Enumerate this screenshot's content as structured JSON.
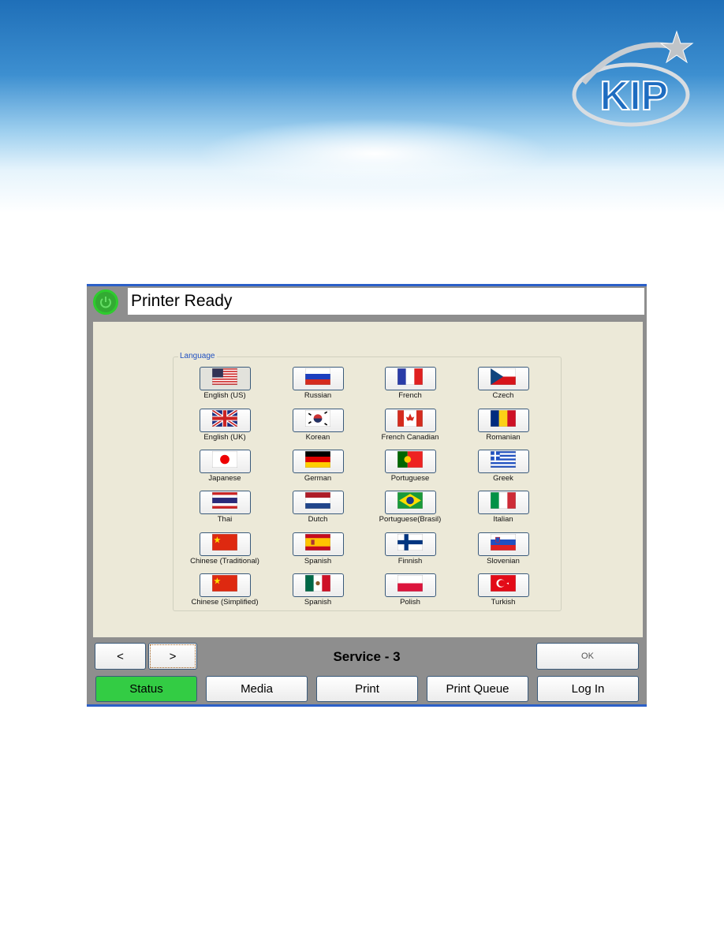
{
  "brand": {
    "logo_text": "KIP",
    "colors": {
      "banner": "#1f6fb8",
      "logo": "#1e6cc0"
    }
  },
  "window": {
    "title": "Printer Ready",
    "power_icon": "power-icon",
    "power_color": "#2ecc2e"
  },
  "language_group": {
    "label": "Language",
    "selected": "English (US)",
    "items": [
      {
        "label": "English (US)",
        "flag": "us"
      },
      {
        "label": "Russian",
        "flag": "ru"
      },
      {
        "label": "French",
        "flag": "fr"
      },
      {
        "label": "Czech",
        "flag": "cz"
      },
      {
        "label": "English (UK)",
        "flag": "uk"
      },
      {
        "label": "Korean",
        "flag": "kr"
      },
      {
        "label": "French Canadian",
        "flag": "ca"
      },
      {
        "label": "Romanian",
        "flag": "ro"
      },
      {
        "label": "Japanese",
        "flag": "jp"
      },
      {
        "label": "German",
        "flag": "de"
      },
      {
        "label": "Portuguese",
        "flag": "pt"
      },
      {
        "label": "Greek",
        "flag": "gr"
      },
      {
        "label": "Thai",
        "flag": "th"
      },
      {
        "label": "Dutch",
        "flag": "nl"
      },
      {
        "label": "Portuguese(Brasil)",
        "flag": "br"
      },
      {
        "label": "Italian",
        "flag": "it"
      },
      {
        "label": "Chinese (Traditional)",
        "flag": "cn"
      },
      {
        "label": "Spanish",
        "flag": "es"
      },
      {
        "label": "Finnish",
        "flag": "fi"
      },
      {
        "label": "Slovenian",
        "flag": "si"
      },
      {
        "label": "Chinese (Simplified)",
        "flag": "cn"
      },
      {
        "label": "Spanish",
        "flag": "mx"
      },
      {
        "label": "Polish",
        "flag": "pl"
      },
      {
        "label": "Turkish",
        "flag": "tr"
      }
    ]
  },
  "pager": {
    "prev": "<",
    "next": ">",
    "page_label": "Service - 3"
  },
  "ok_label": "OK",
  "tabs": [
    {
      "label": "Status",
      "active": true,
      "color": "#33cc44"
    },
    {
      "label": "Media"
    },
    {
      "label": "Print"
    },
    {
      "label": "Print Queue"
    },
    {
      "label": "Log In"
    }
  ]
}
